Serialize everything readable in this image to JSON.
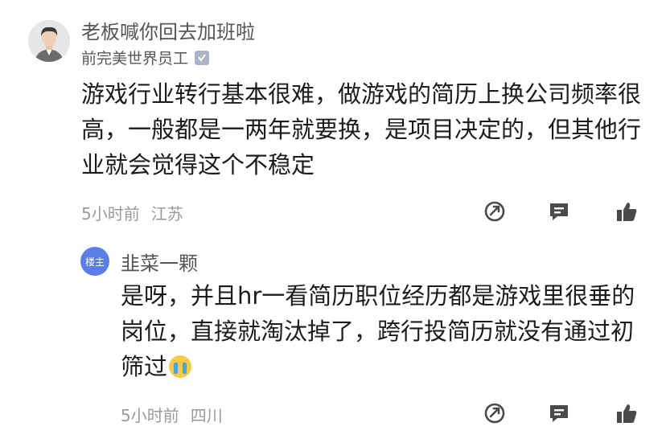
{
  "comment": {
    "username": "老板喊你回去加班啦",
    "user_title": "前完美世界员工",
    "text": "游戏行业转行基本很难，做游戏的简历上换公司频率很高，一般都是一两年就要换，是项目决定的，但其他行业就会觉得这个不稳定",
    "time": "5小时前",
    "location": "江苏"
  },
  "reply": {
    "badge": "楼主",
    "username": "韭菜一颗",
    "text": "是呀，并且hr一看简历职位经历都是游戏里很垂的岗位，直接就淘汰掉了，跨行投简历就没有通过初筛过",
    "emoji": "crying-face-emoji",
    "time": "5小时前",
    "location": "四川"
  },
  "colors": {
    "accent": "#5b7de8",
    "meta": "#9a9a9a",
    "icon": "#4a4a4a"
  }
}
